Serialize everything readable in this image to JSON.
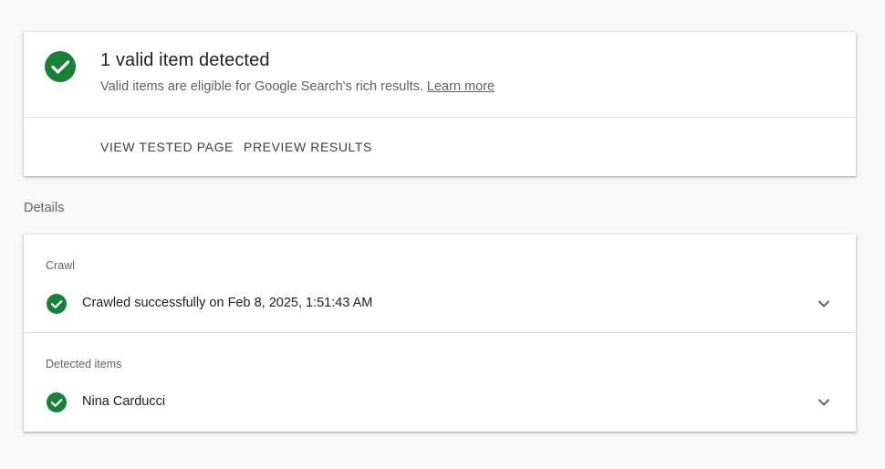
{
  "summary": {
    "title": "1 valid item detected",
    "description": "Valid items are eligible for Google Search's rich results.",
    "learn_more": "Learn more",
    "actions": {
      "view_tested_page": "VIEW TESTED PAGE",
      "preview_results": "PREVIEW RESULTS"
    }
  },
  "details": {
    "heading": "Details",
    "sections": [
      {
        "label": "Crawl",
        "item_text": "Crawled successfully on Feb 8, 2025, 1:51:43 AM",
        "status_icon": "check-circle-icon",
        "expand_icon": "chevron-down-icon"
      },
      {
        "label": "Detected items",
        "item_text": "Nina Carducci",
        "status_icon": "check-circle-icon",
        "expand_icon": "chevron-down-icon"
      }
    ]
  },
  "colors": {
    "success_green": "#188038",
    "background": "#f8f8f8"
  }
}
